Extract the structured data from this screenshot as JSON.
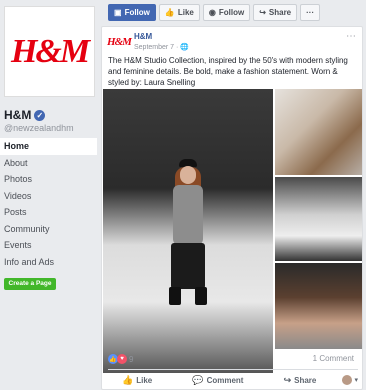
{
  "sidebar": {
    "logo_text": "H&M",
    "page_name": "H&M",
    "handle": "@newzealandhm",
    "nav": [
      {
        "label": "Home",
        "active": true
      },
      {
        "label": "About",
        "active": false
      },
      {
        "label": "Photos",
        "active": false
      },
      {
        "label": "Videos",
        "active": false
      },
      {
        "label": "Posts",
        "active": false
      },
      {
        "label": "Community",
        "active": false
      },
      {
        "label": "Events",
        "active": false
      },
      {
        "label": "Info and Ads",
        "active": false
      }
    ],
    "create_page_label": "Create a Page"
  },
  "topbar": {
    "follow_primary": "Follow",
    "like": "Like",
    "follow": "Follow",
    "share": "Share",
    "more": "···"
  },
  "post": {
    "author": "H&M",
    "logo_text": "H&M",
    "date": "September 7 · ",
    "text": "The H&M Studio Collection, inspired by the 50's with modern styling and feminine details. Be bold, make a fashion statement. Worn & styled by: Laura Snelling",
    "reaction_count": "9",
    "comment_count": "1 Comment",
    "actions": {
      "like": "Like",
      "comment": "Comment",
      "share": "Share"
    }
  },
  "colors": {
    "brand_red": "#e50010",
    "facebook_blue": "#4267b2",
    "create_green": "#42b72a"
  }
}
